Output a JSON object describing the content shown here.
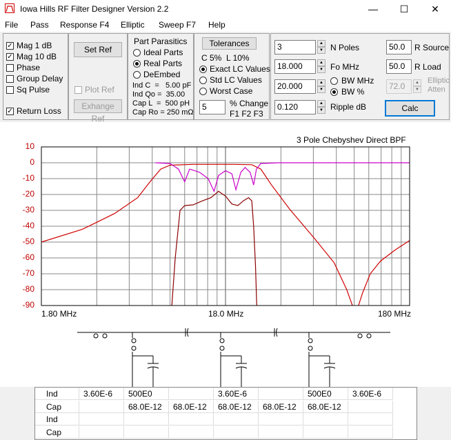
{
  "window": {
    "title": "Iowa Hills RF Filter Designer  Version 2.2",
    "minimize": "—",
    "maximize": "☐",
    "close": "✕"
  },
  "menu": [
    "File",
    "Pass",
    "Response F4",
    "Elliptic",
    "Sweep F7",
    "Help"
  ],
  "display_options": [
    {
      "label": "Mag   1 dB",
      "checked": true
    },
    {
      "label": "Mag 10 dB",
      "checked": true
    },
    {
      "label": "Phase",
      "checked": false
    },
    {
      "label": "Group Delay",
      "checked": false
    },
    {
      "label": "Sq Pulse",
      "checked": false
    },
    {
      "label": "Return Loss",
      "checked": true
    }
  ],
  "ref": {
    "set_ref": "Set Ref",
    "plot_ref": "Plot Ref",
    "exchange_ref": "Exhange Ref"
  },
  "parasitics": {
    "title": "Part Parasitics",
    "options": [
      "Ideal Parts",
      "Real Parts",
      "DeEmbed"
    ],
    "selected": 1,
    "lines": [
      "Ind C  =   5.00 pF",
      "Ind Qo =  35.00",
      "Cap L  =  500 pH",
      "Cap Ro = 250 mΩ"
    ]
  },
  "tolerances": {
    "button": "Tolerances",
    "c_label": "C 5%",
    "l_label": "L 10%",
    "options": [
      "Exact LC Values",
      "Std LC Values",
      "Worst Case"
    ],
    "selected": 0,
    "change_value": "5",
    "change_label": "% Change",
    "f_label": "F1 F2 F3"
  },
  "params": {
    "n_poles": {
      "value": "3",
      "label": "N Poles"
    },
    "fo": {
      "value": "18.000",
      "label": "Fo  MHz"
    },
    "bw": {
      "value": "20.000"
    },
    "ripple": {
      "value": "0.120",
      "label": "Ripple  dB"
    },
    "bw_mhz_label": "BW MHz",
    "bw_pct_label": "BW %",
    "bw_selected": "pct",
    "r_source": {
      "value": "50.0",
      "label": "R Source"
    },
    "r_load": {
      "value": "50.0",
      "label": "R Load"
    },
    "elliptic_atten": {
      "value": "72.0",
      "label1": "Elliptic",
      "label2": "Atten"
    },
    "calc": "Calc"
  },
  "chart_data": {
    "type": "line",
    "title": "3 Pole Chebyshev Direct BPF",
    "x_scale": "log",
    "xlim": [
      1.8,
      180
    ],
    "x_tick_labels": [
      "1.80 MHz",
      "18.0 MHz",
      "180 MHz"
    ],
    "ylim": [
      -90,
      10
    ],
    "y_tick_labels": [
      "10",
      "0",
      "-10",
      "-20",
      "-30",
      "-40",
      "-50",
      "-60",
      "-70",
      "-80",
      "-90"
    ],
    "grid": true,
    "series": [
      {
        "color": "#d00000",
        "points": [
          [
            1.8,
            -50
          ],
          [
            3,
            -42
          ],
          [
            4.5,
            -32
          ],
          [
            6,
            -22
          ],
          [
            7,
            -12
          ],
          [
            8,
            -4
          ],
          [
            9,
            -1.5
          ],
          [
            12,
            -1
          ],
          [
            16,
            -1
          ],
          [
            20,
            -1
          ],
          [
            25,
            -1.2
          ],
          [
            28,
            -4
          ],
          [
            32,
            -14
          ],
          [
            40,
            -29
          ],
          [
            55,
            -48
          ],
          [
            70,
            -63
          ],
          [
            82,
            -80
          ],
          [
            88,
            -90
          ]
        ]
      },
      {
        "color": "#d00000",
        "points": [
          [
            95,
            -90
          ],
          [
            100,
            -82
          ],
          [
            110,
            -70
          ],
          [
            125,
            -62
          ],
          [
            150,
            -55
          ],
          [
            180,
            -49
          ]
        ]
      },
      {
        "color": "#8b0000",
        "points": [
          [
            9.2,
            -90
          ],
          [
            9.6,
            -60
          ],
          [
            10.2,
            -30
          ],
          [
            10.8,
            -27
          ],
          [
            12,
            -26.5
          ],
          [
            13.5,
            -24
          ],
          [
            15,
            -22
          ],
          [
            16.5,
            -18
          ],
          [
            18,
            -21
          ],
          [
            19.5,
            -26
          ],
          [
            21,
            -27
          ],
          [
            22.5,
            -24
          ],
          [
            24,
            -22
          ],
          [
            25,
            -24
          ],
          [
            25.6,
            -40
          ],
          [
            26.2,
            -65
          ],
          [
            26.6,
            -90
          ]
        ]
      },
      {
        "color": "#cc00cc",
        "points": [
          [
            7.5,
            0
          ],
          [
            9,
            -0.5
          ],
          [
            10,
            -4
          ],
          [
            10.8,
            -12
          ],
          [
            11.5,
            -4
          ],
          [
            13,
            -6
          ],
          [
            14.5,
            -10
          ],
          [
            15.6,
            -18
          ],
          [
            16.5,
            -8
          ],
          [
            18,
            -5
          ],
          [
            19.5,
            -7
          ],
          [
            20.5,
            -17
          ],
          [
            21.8,
            -6
          ],
          [
            23,
            -3
          ],
          [
            24.5,
            -6
          ],
          [
            25.6,
            -14
          ],
          [
            26.5,
            -4
          ],
          [
            28,
            -0.5
          ],
          [
            35,
            0
          ],
          [
            180,
            0
          ]
        ]
      }
    ]
  },
  "schematic": {
    "rows": [
      {
        "label": "Ind",
        "cells": [
          "3.60E-6",
          "500E0",
          "",
          "3.60E-6",
          "",
          "500E0",
          "3.60E-6"
        ]
      },
      {
        "label": "Cap",
        "cells": [
          "",
          "68.0E-12",
          "68.0E-12",
          "68.0E-12",
          "68.0E-12",
          "68.0E-12",
          ""
        ]
      },
      {
        "label": "Ind",
        "cells": [
          "",
          "",
          "",
          "",
          "",
          "",
          ""
        ]
      },
      {
        "label": "Cap",
        "cells": [
          "",
          "",
          "",
          "",
          "",
          "",
          ""
        ]
      }
    ]
  }
}
